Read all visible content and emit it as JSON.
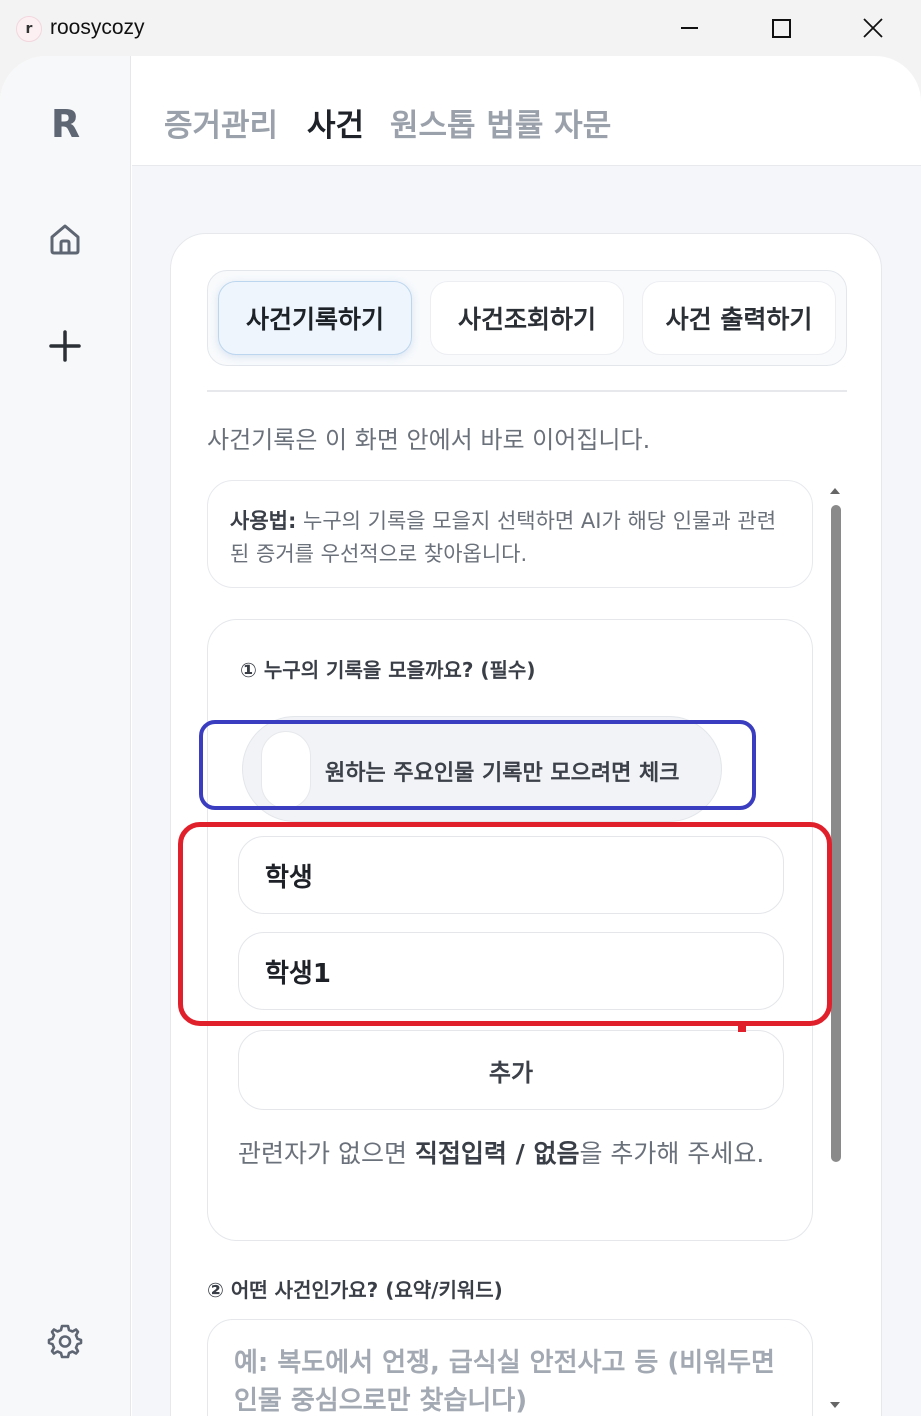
{
  "window": {
    "app_icon_letter": "r",
    "title": "roosycozy"
  },
  "sidebar": {
    "logo": "R",
    "icons": [
      "home-icon",
      "plus-icon",
      "gear-icon"
    ]
  },
  "topnav": {
    "items": [
      "증거관리",
      "사건",
      "원스톱 법률 자문"
    ],
    "active": "사건"
  },
  "tabs": [
    {
      "label": "사건기록하기",
      "active": true
    },
    {
      "label": "사건조회하기",
      "active": false
    },
    {
      "label": "사건 출력하기",
      "active": false
    }
  ],
  "intro": "사건기록은 이 화면 안에서 바로 이어집니다.",
  "usage": {
    "label": "사용법:",
    "text": " 누구의 기록을 모을지 선택하면 AI가 해당 인물과 관련된 증거를 우선적으로 찾아옵니다."
  },
  "who": {
    "title": "① 누구의 기록을 모을까요? (필수)",
    "toggle_label": "원하는 주요인물 기록만 모으려면 체크",
    "people": [
      "학생",
      "학생1"
    ],
    "add_button": "추가",
    "hint_pre": "관련자가 없으면 ",
    "hint_bold": "직접입력 / 없음",
    "hint_post": "을 추가해 주세요."
  },
  "q2": {
    "title": "② 어떤 사건인가요? (요약/키워드)",
    "placeholder": "예: 복도에서 언쟁, 급식실 안전사고 등 (비워두면 인물 중심으로만 찾습니다)"
  },
  "colors": {
    "annotation_blue": "#3a3dbf",
    "annotation_red": "#e0202b",
    "active_tab_bg": "#eef5fc"
  }
}
